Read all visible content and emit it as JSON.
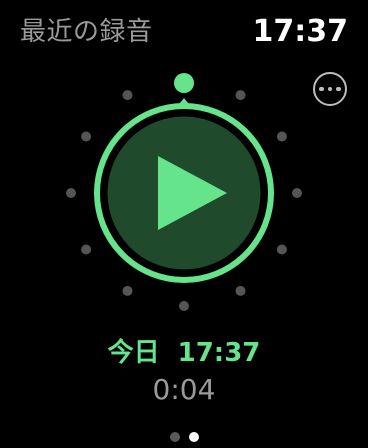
{
  "header": {
    "title": "最近の録音",
    "time": "17:37"
  },
  "menu": {
    "icon": "ellipsis-circle-icon"
  },
  "player": {
    "icon": "play-icon",
    "accent_color": "#66e48c",
    "fill_color": "#1f4a2c",
    "dial_dot_color": "#555555"
  },
  "recording": {
    "date_label": "今日",
    "time": "17:37",
    "duration": "0:04"
  },
  "pagination": {
    "current_page": 2,
    "total_pages": 2
  }
}
